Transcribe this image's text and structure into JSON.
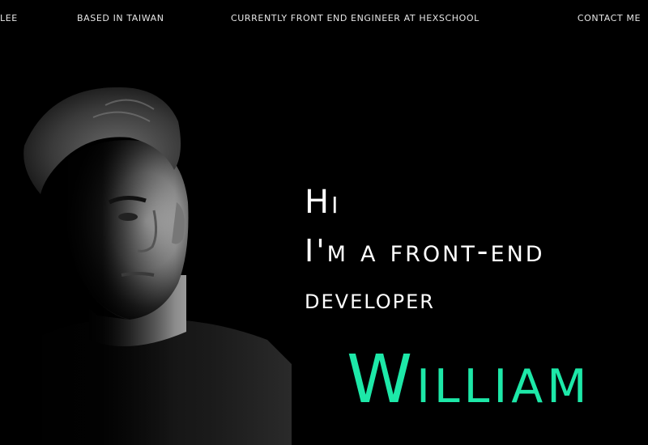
{
  "nav": {
    "name_text": "LEE",
    "location_text": "BASED IN TAIWAN",
    "current_text": "CURRENTLY FRONT END ENGINEER AT HEXSCHOOL",
    "contact_label": "CONTACT ME"
  },
  "hero": {
    "greeting": "Hi",
    "line2": "I'm a front-end",
    "line3": "developer",
    "name": "William"
  },
  "colors": {
    "background": "#000000",
    "accent": "#1de8a8",
    "text": "#ffffff"
  }
}
